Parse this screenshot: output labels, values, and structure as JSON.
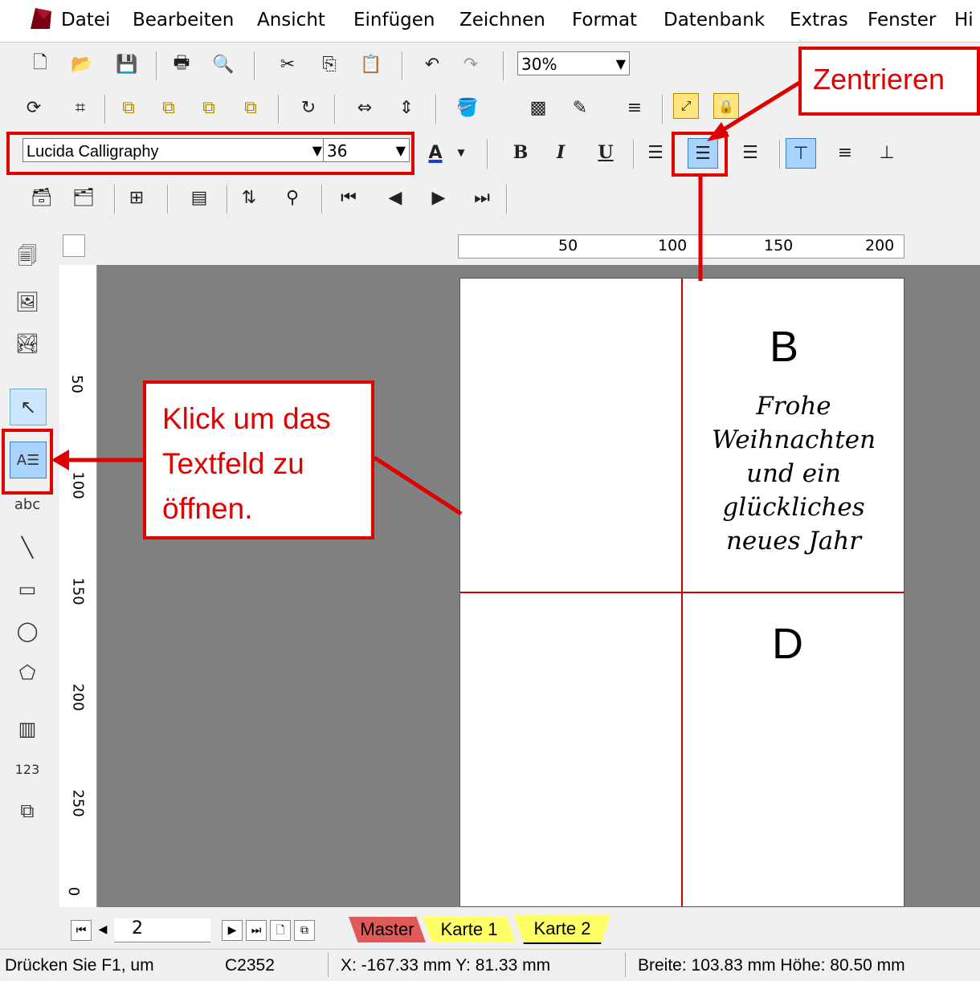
{
  "menu": [
    "Datei",
    "Bearbeiten",
    "Ansicht",
    "Einfügen",
    "Zeichnen",
    "Format",
    "Datenbank",
    "Extras",
    "Fenster",
    "Hi"
  ],
  "toolbar": {
    "zoom_value": "30%",
    "font_name": "Lucida Calligraphy",
    "font_size": "36",
    "bold_label": "B",
    "italic_label": "I",
    "underline_label": "U",
    "font_color_label": "A"
  },
  "ruler_h_labels": [
    "50",
    "100",
    "150",
    "200"
  ],
  "ruler_v_labels": [
    "50",
    "100",
    "150",
    "200",
    "250",
    "0"
  ],
  "card": {
    "quad_b_letter": "B",
    "greeting_lines": [
      "Frohe",
      "Weihnachten",
      "und ein",
      "glückliches",
      "neues Jahr"
    ],
    "quad_d_letter": "D"
  },
  "callouts": {
    "center_label": "Zentrieren",
    "textfield_lines": [
      "Klick um das",
      "Textfeld zu",
      "öffnen."
    ]
  },
  "nav": {
    "page_number": "2"
  },
  "tabs": [
    "Master",
    "Karte 1",
    "Karte 2"
  ],
  "status": {
    "help": "Drücken Sie F1, um",
    "code": "C2352",
    "coords": "X: -167.33 mm  Y: 81.33 mm",
    "size": "Breite: 103.83 mm  Höhe: 80.50 mm"
  },
  "colors": {
    "accent": "#e00000",
    "master_tab": "#e05a5a",
    "karte_tab": "#ffff66"
  }
}
